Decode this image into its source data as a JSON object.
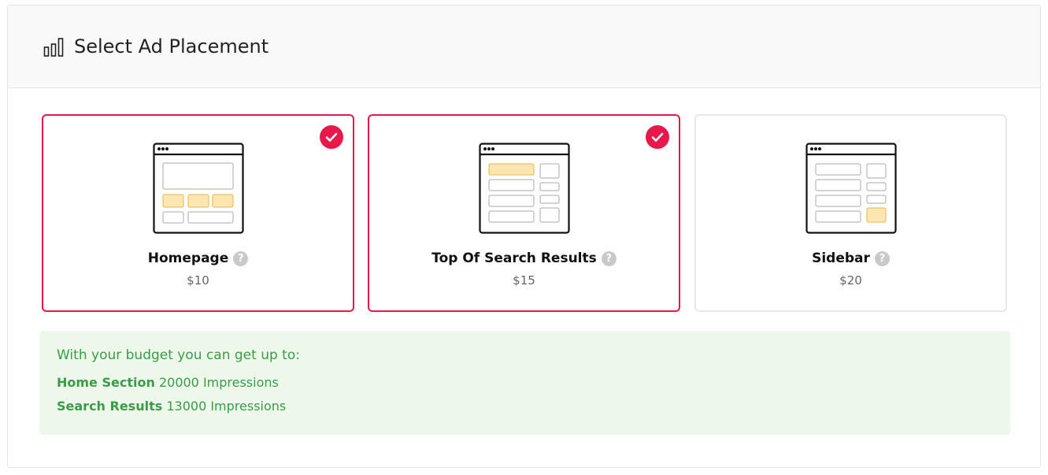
{
  "header": {
    "title": "Select Ad Placement",
    "icon": "bar-chart-icon"
  },
  "placements": [
    {
      "name": "Homepage",
      "price": "$10",
      "selected": true,
      "help_icon": "question-icon",
      "illustration": "homepage-layout-icon"
    },
    {
      "name": "Top Of Search Results",
      "price": "$15",
      "selected": true,
      "help_icon": "question-icon",
      "illustration": "search-results-layout-icon"
    },
    {
      "name": "Sidebar",
      "price": "$20",
      "selected": false,
      "help_icon": "question-icon",
      "illustration": "sidebar-layout-icon"
    }
  ],
  "budget": {
    "title": "With your budget you can get up to:",
    "lines": [
      {
        "label": "Home Section",
        "value": "20000 Impressions"
      },
      {
        "label": "Search Results",
        "value": "13000 Impressions"
      }
    ]
  },
  "colors": {
    "accent": "#e6194a",
    "success_text": "#3a9b49",
    "success_bg": "#edf8ea",
    "ad_highlight": "#fde6b0"
  }
}
